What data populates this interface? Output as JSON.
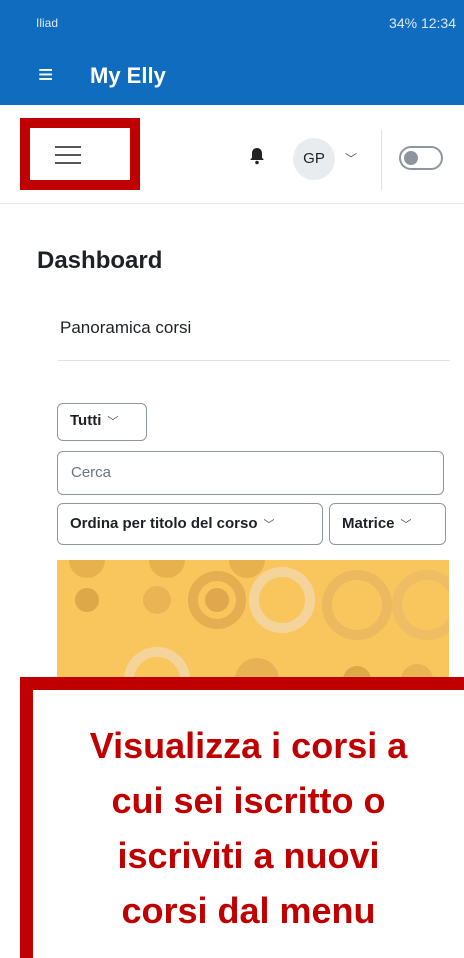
{
  "statusbar": {
    "carrier": "Iliad",
    "right": "34%  12:34"
  },
  "appbar": {
    "title": "My Elly"
  },
  "topnav": {
    "avatar_initials": "GP"
  },
  "dashboard": {
    "title": "Dashboard",
    "panel_title": "Panoramica corsi",
    "filter_label": "Tutti",
    "search_placeholder": "Cerca",
    "sort_label": "Ordina per titolo del corso",
    "view_label": "Matrice"
  },
  "banner": {
    "line1": "Visualizza i corsi a",
    "line2": "cui sei iscritto o",
    "line3": "iscriviti a nuovi",
    "line4": "corsi dal menu"
  },
  "colors": {
    "brand": "#0f6cbf",
    "highlight": "#c00000",
    "course_bg": "#f8c65c"
  }
}
